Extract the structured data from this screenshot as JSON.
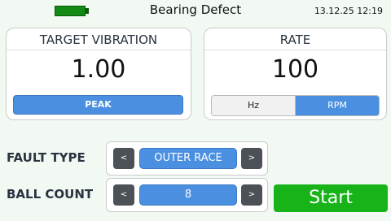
{
  "status_bar": {
    "title": "Bearing Defect",
    "datetime": "13.12.25 12:19",
    "battery_icon": "battery-full-icon",
    "battery_level": 1.0,
    "battery_color": "#138a13"
  },
  "target_vibration": {
    "title": "TARGET VIBRATION",
    "value": "1.00",
    "mode_label": "PEAK"
  },
  "rate": {
    "title": "RATE",
    "value": "100",
    "units": [
      "Hz",
      "RPM"
    ],
    "selected_unit": "RPM"
  },
  "fault_type": {
    "label": "FAULT TYPE",
    "value": "OUTER RACE",
    "prev_label": "<",
    "next_label": ">"
  },
  "ball_count": {
    "label": "BALL COUNT",
    "value": "8",
    "prev_label": "<",
    "next_label": ">"
  },
  "start_button": {
    "label": "Start",
    "color": "#18b318"
  },
  "colors": {
    "accent": "#4a8fe0",
    "arrow_bg": "#4b5157",
    "background": "#f2f8f2"
  }
}
